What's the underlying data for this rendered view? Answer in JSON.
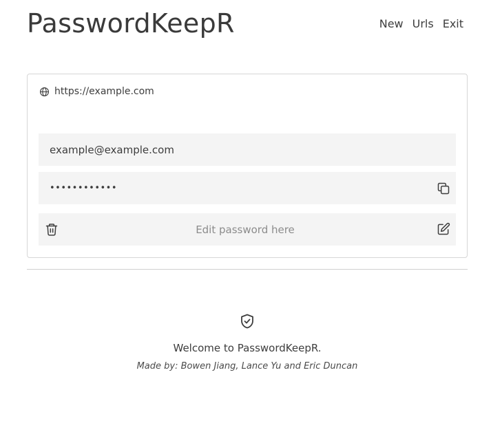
{
  "header": {
    "brand": "PasswordKeepR",
    "nav": [
      "New",
      "Urls",
      "Exit"
    ]
  },
  "card": {
    "url": "https://example.com",
    "email": "example@example.com",
    "password_masked": "••••••••••••",
    "edit_placeholder": "Edit password here",
    "icons": {
      "url": "globe-icon",
      "copy": "copy-icon",
      "delete": "trash-icon",
      "edit": "edit-icon"
    }
  },
  "footer": {
    "icon": "shield-check-icon",
    "welcome": "Welcome to PasswordKeepR.",
    "credits": "Made by: Bowen Jiang, Lance Yu and Eric Duncan"
  }
}
